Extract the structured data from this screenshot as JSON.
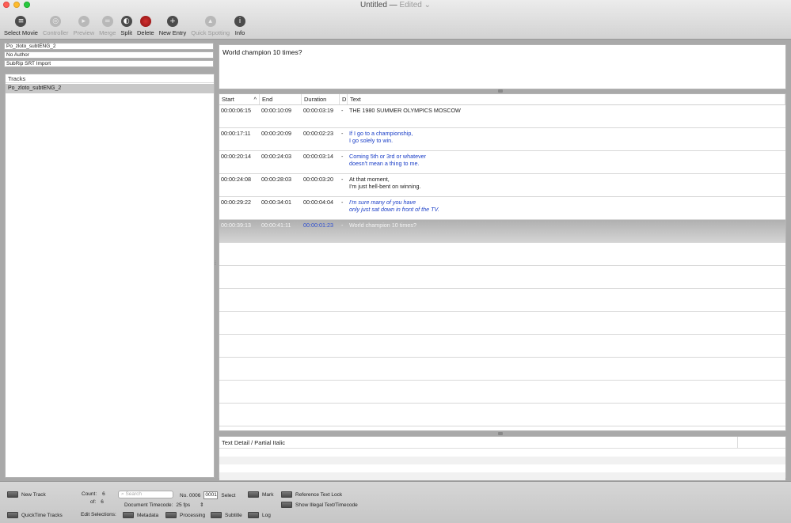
{
  "window": {
    "title": "Untitled —",
    "status": "Edited",
    "status_chevron": "⌄"
  },
  "toolbar": {
    "items": [
      {
        "label": "Select Movie",
        "icon": "select-movie-icon",
        "glyph": "≡",
        "enabled": true
      },
      {
        "label": "Controller",
        "icon": "controller-icon",
        "glyph": "◎",
        "enabled": false
      },
      {
        "label": "Preview",
        "icon": "preview-icon",
        "glyph": "▸",
        "enabled": false
      },
      {
        "label": "Merge",
        "icon": "merge-icon",
        "glyph": "=",
        "enabled": false
      },
      {
        "label": "Split",
        "icon": "split-icon",
        "glyph": "◐",
        "enabled": true
      },
      {
        "label": "Delete",
        "icon": "delete-icon",
        "glyph": "",
        "enabled": true
      },
      {
        "label": "New Entry",
        "icon": "new-entry-icon",
        "glyph": "+",
        "enabled": true
      },
      {
        "label": "Quick Spotting",
        "icon": "quick-spotting-icon",
        "glyph": "▴",
        "enabled": false
      },
      {
        "label": "Info",
        "icon": "info-icon",
        "glyph": "i",
        "enabled": true
      }
    ]
  },
  "metadata": {
    "title": "Po_zloto_subtENG_2",
    "author": "No Author",
    "source": "SubRip SRT Import"
  },
  "tracks": {
    "header": "Tracks",
    "items": [
      "Po_zloto_subtENG_2"
    ]
  },
  "preview_text": "World champion 10 times?",
  "table": {
    "columns": {
      "start": "Start",
      "sort_indicator": "^",
      "end": "End",
      "duration": "Duration",
      "d": "D",
      "text": "Text"
    },
    "rows": [
      {
        "start": "00:00:06:15",
        "end": "00:00:10:09",
        "duration": "00:00:03:19",
        "d": "-",
        "text": "THE 1980 SUMMER OLYMPICS MOSCOW",
        "style": "normal"
      },
      {
        "start": "00:00:17:11",
        "end": "00:00:20:09",
        "duration": "00:00:02:23",
        "d": "-",
        "text": "If I go to a championship,\nI go solely to win.",
        "style": "blue"
      },
      {
        "start": "00:00:20:14",
        "end": "00:00:24:03",
        "duration": "00:00:03:14",
        "d": "-",
        "text": "Coming 5th or 3rd or whatever\ndoesn't mean a thing to me.",
        "style": "blue"
      },
      {
        "start": "00:00:24:08",
        "end": "00:00:28:03",
        "duration": "00:00:03:20",
        "d": "-",
        "text": "At that moment,\nI'm just hell-bent on winning.",
        "style": "normal"
      },
      {
        "start": "00:00:29:22",
        "end": "00:00:34:01",
        "duration": "00:00:04:04",
        "d": "-",
        "text": "I'm sure many of you have\nonly just sat down in front of the TV.",
        "style": "italic"
      },
      {
        "start": "00:00:39:13",
        "end": "00:00:41:11",
        "duration": "00:00:01:23",
        "d": "-",
        "text": "World champion 10 times?",
        "style": "sel"
      }
    ]
  },
  "detail": {
    "header": "Text Detail / Partial Italic"
  },
  "bottom": {
    "new_track": "New Track",
    "quicktime_tracks": "QuickTime Tracks",
    "count_label": "Count:",
    "count_value": "6",
    "of_label": "of:",
    "of_value": "6",
    "edit_selections": "Edit Selections:",
    "search_placeholder": "Search",
    "no_label": "No. 0006",
    "no_input": "0001",
    "select": "Select",
    "doc_timecode_label": "Document Timecode:",
    "fps": "25 fps",
    "fps_chevron": "⇕",
    "mark": "Mark",
    "reference_text_lock": "Reference Text Lock",
    "show_illegal": "Show Illegal Text/Timecode",
    "metadata": "Metadata",
    "processing": "Processing",
    "subtitle": "Subtitle",
    "log": "Log"
  }
}
